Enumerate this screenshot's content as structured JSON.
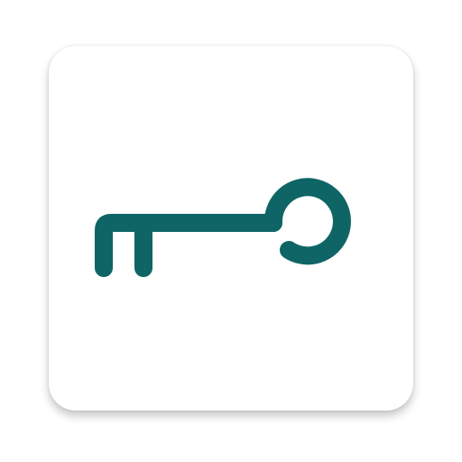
{
  "app_icon": {
    "glyph": "key-icon",
    "tile_color": "#ffffff",
    "accent_color": "#0f6565"
  }
}
